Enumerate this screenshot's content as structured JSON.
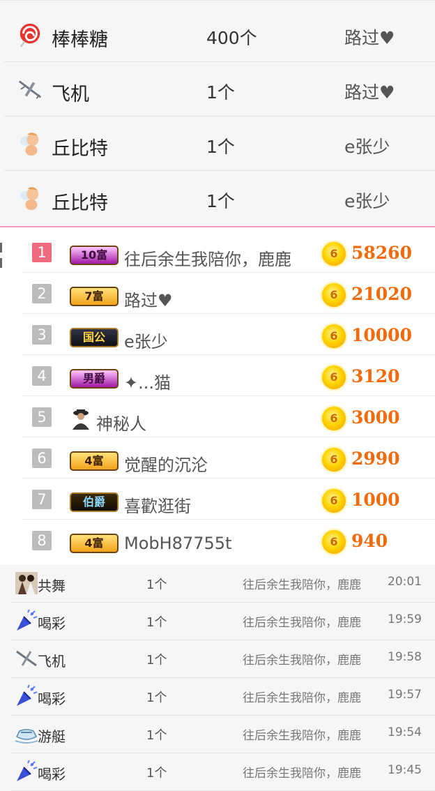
{
  "gift_top": [
    {
      "icon": "lollipop-icon",
      "name": "棒棒糖",
      "count": "400个",
      "user": "路过♥"
    },
    {
      "icon": "airplane-icon",
      "name": "飞机",
      "count": "1个",
      "user": "路过♥"
    },
    {
      "icon": "cupid-icon",
      "name": "丘比特",
      "count": "1个",
      "user": "e张少"
    },
    {
      "icon": "cupid-icon",
      "name": "丘比特",
      "count": "1个",
      "user": "e张少"
    }
  ],
  "ranking": [
    {
      "rank": "1",
      "badge": "10富",
      "badge_style": "purple",
      "name": "往后余生我陪你，鹿鹿",
      "coin": "6",
      "score": "58260"
    },
    {
      "rank": "2",
      "badge": "7富",
      "badge_style": "gold",
      "name": "路过♥",
      "coin": "6",
      "score": "21020"
    },
    {
      "rank": "3",
      "badge": "国公",
      "badge_style": "dark",
      "name": "e张少",
      "coin": "6",
      "score": "10000"
    },
    {
      "rank": "4",
      "badge": "男爵",
      "badge_style": "purple",
      "name": "✦...猫",
      "coin": "6",
      "score": "3120"
    },
    {
      "rank": "5",
      "badge": "",
      "badge_style": "mystery",
      "name": "神秘人",
      "coin": "6",
      "score": "3000"
    },
    {
      "rank": "6",
      "badge": "4富",
      "badge_style": "gold",
      "name": "觉醒的沉沦",
      "coin": "6",
      "score": "2990"
    },
    {
      "rank": "7",
      "badge": "伯爵",
      "badge_style": "dark2",
      "name": "喜歡逛街",
      "coin": "6",
      "score": "1000"
    },
    {
      "rank": "8",
      "badge": "4富",
      "badge_style": "gold",
      "name": "MobH87755t",
      "coin": "6",
      "score": "940"
    }
  ],
  "history": [
    {
      "icon": "dance-couple-icon",
      "name": "共舞",
      "count": "1个",
      "user": "往后余生我陪你，鹿鹿",
      "time": "20:01"
    },
    {
      "icon": "party-popper-icon",
      "name": "喝彩",
      "count": "1个",
      "user": "往后余生我陪你，鹿鹿",
      "time": "19:59"
    },
    {
      "icon": "airplane-icon",
      "name": "飞机",
      "count": "1个",
      "user": "往后余生我陪你，鹿鹿",
      "time": "19:58"
    },
    {
      "icon": "party-popper-icon",
      "name": "喝彩",
      "count": "1个",
      "user": "往后余生我陪你，鹿鹿",
      "time": "19:57"
    },
    {
      "icon": "yacht-icon",
      "name": "游艇",
      "count": "1个",
      "user": "往后余生我陪你，鹿鹿",
      "time": "19:54"
    },
    {
      "icon": "party-popper-icon",
      "name": "喝彩",
      "count": "1个",
      "user": "往后余生我陪你，鹿鹿",
      "time": "19:45"
    }
  ],
  "colors": {
    "accent_line": "#ef9bc1",
    "score": "#f26a0a",
    "rank_first": "#f06a7f",
    "rank_other": "#bcbcbc"
  }
}
